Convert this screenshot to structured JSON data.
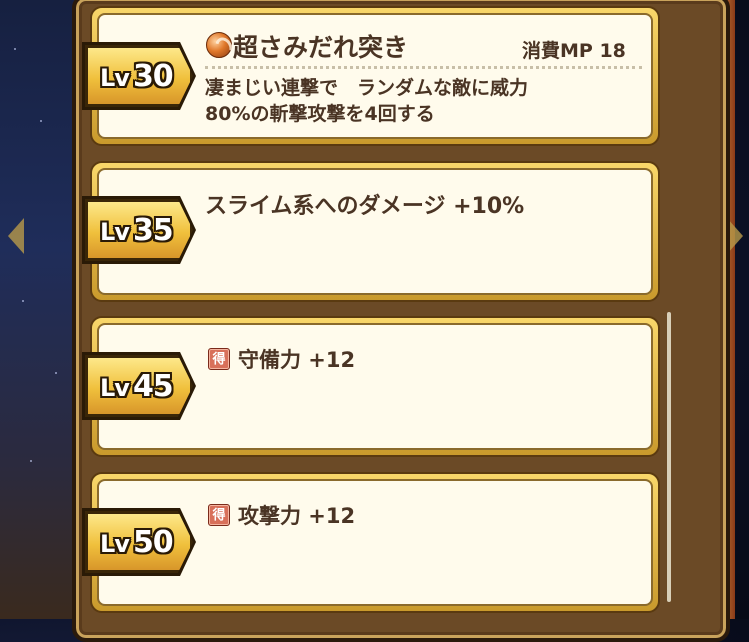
{
  "cards": [
    {
      "level_prefix": "Lv",
      "level": "30",
      "skill_name": "超さみだれ突き",
      "mp_cost": "消費MP 18",
      "description_line1": "凄まじい連撃で　ランダムな敵に威力",
      "description_line2": "80%の斬撃攻撃を4回する",
      "icon": "slash-skill-orb-icon"
    },
    {
      "level_prefix": "Lv",
      "level": "35",
      "effect": "スライム系へのダメージ +10%"
    },
    {
      "level_prefix": "Lv",
      "level": "45",
      "badge": "得",
      "effect": "守備力 +12"
    },
    {
      "level_prefix": "Lv",
      "level": "50",
      "badge": "得",
      "effect": "攻撃力 +12"
    }
  ],
  "colors": {
    "card_frame": "#e2b23c",
    "card_fill": "#fffbec",
    "text": "#4a3424",
    "panel": "#6b4a26",
    "badge_fill": "#d8705a"
  }
}
